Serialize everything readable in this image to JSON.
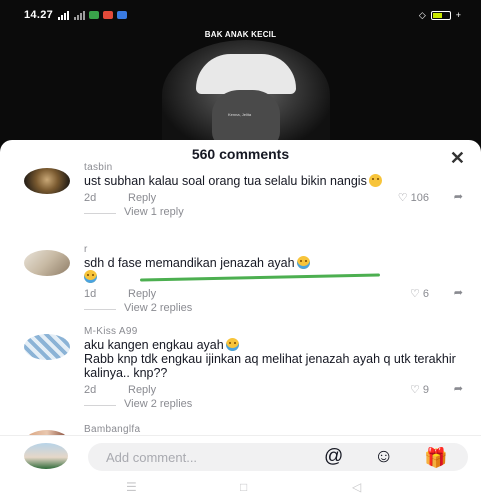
{
  "status_bar": {
    "time": "14.27",
    "battery_color": "#c8e600"
  },
  "video": {
    "title": "BAK ANAK KECIL",
    "watermark": "Kenna, Jelita"
  },
  "sheet": {
    "comment_count_label": "560 comments",
    "close_icon": "close-icon"
  },
  "comments": [
    {
      "username": "tasbin",
      "text": "ust subhan kalau soal orang tua selalu bikin nangis",
      "emoji": "pensive-face",
      "date": "2d",
      "reply_label": "Reply",
      "likes": "106",
      "view_replies": "View 1 reply"
    },
    {
      "username": "r",
      "text": "sdh d fase memandikan jenazah ayah",
      "emoji": "crying-face",
      "date": "1d",
      "reply_label": "Reply",
      "likes": "6",
      "view_replies": "View 2 replies"
    },
    {
      "username": "M-Kiss A99",
      "line1": "aku kangen engkau ayah",
      "line2": "Rabb knp tdk engkau ijinkan aq melihat jenazah ayah q utk terakhir kalinya.. knp??",
      "emoji": "crying-face",
      "date": "2d",
      "reply_label": "Reply",
      "likes": "9",
      "view_replies": "View 2 replies"
    },
    {
      "username": "Bambanglfa",
      "partial_text": "..."
    }
  ],
  "input_bar": {
    "placeholder": "Add comment...",
    "icons": [
      "at-icon",
      "emoji-icon",
      "gift-icon"
    ]
  },
  "nav_bar": {
    "icons": [
      "recents-icon",
      "home-icon",
      "back-icon"
    ]
  }
}
